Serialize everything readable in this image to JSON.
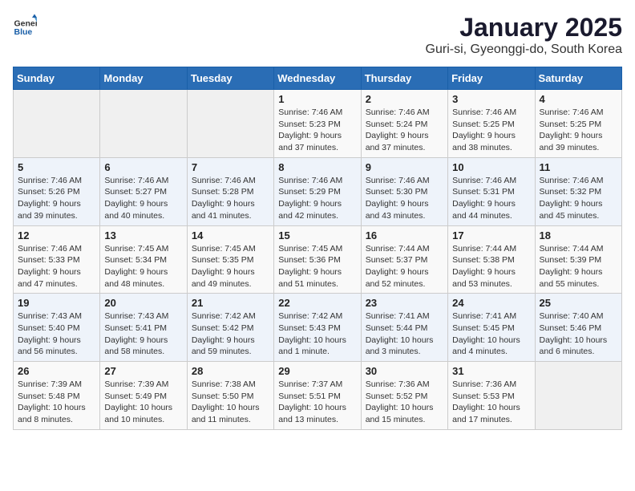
{
  "header": {
    "logo": {
      "general": "General",
      "blue": "Blue"
    },
    "title": "January 2025",
    "subtitle": "Guri-si, Gyeonggi-do, South Korea"
  },
  "weekdays": [
    "Sunday",
    "Monday",
    "Tuesday",
    "Wednesday",
    "Thursday",
    "Friday",
    "Saturday"
  ],
  "weeks": [
    [
      {
        "day": "",
        "sunrise": "",
        "sunset": "",
        "daylight": ""
      },
      {
        "day": "",
        "sunrise": "",
        "sunset": "",
        "daylight": ""
      },
      {
        "day": "",
        "sunrise": "",
        "sunset": "",
        "daylight": ""
      },
      {
        "day": "1",
        "sunrise": "Sunrise: 7:46 AM",
        "sunset": "Sunset: 5:23 PM",
        "daylight": "Daylight: 9 hours and 37 minutes."
      },
      {
        "day": "2",
        "sunrise": "Sunrise: 7:46 AM",
        "sunset": "Sunset: 5:24 PM",
        "daylight": "Daylight: 9 hours and 37 minutes."
      },
      {
        "day": "3",
        "sunrise": "Sunrise: 7:46 AM",
        "sunset": "Sunset: 5:25 PM",
        "daylight": "Daylight: 9 hours and 38 minutes."
      },
      {
        "day": "4",
        "sunrise": "Sunrise: 7:46 AM",
        "sunset": "Sunset: 5:25 PM",
        "daylight": "Daylight: 9 hours and 39 minutes."
      }
    ],
    [
      {
        "day": "5",
        "sunrise": "Sunrise: 7:46 AM",
        "sunset": "Sunset: 5:26 PM",
        "daylight": "Daylight: 9 hours and 39 minutes."
      },
      {
        "day": "6",
        "sunrise": "Sunrise: 7:46 AM",
        "sunset": "Sunset: 5:27 PM",
        "daylight": "Daylight: 9 hours and 40 minutes."
      },
      {
        "day": "7",
        "sunrise": "Sunrise: 7:46 AM",
        "sunset": "Sunset: 5:28 PM",
        "daylight": "Daylight: 9 hours and 41 minutes."
      },
      {
        "day": "8",
        "sunrise": "Sunrise: 7:46 AM",
        "sunset": "Sunset: 5:29 PM",
        "daylight": "Daylight: 9 hours and 42 minutes."
      },
      {
        "day": "9",
        "sunrise": "Sunrise: 7:46 AM",
        "sunset": "Sunset: 5:30 PM",
        "daylight": "Daylight: 9 hours and 43 minutes."
      },
      {
        "day": "10",
        "sunrise": "Sunrise: 7:46 AM",
        "sunset": "Sunset: 5:31 PM",
        "daylight": "Daylight: 9 hours and 44 minutes."
      },
      {
        "day": "11",
        "sunrise": "Sunrise: 7:46 AM",
        "sunset": "Sunset: 5:32 PM",
        "daylight": "Daylight: 9 hours and 45 minutes."
      }
    ],
    [
      {
        "day": "12",
        "sunrise": "Sunrise: 7:46 AM",
        "sunset": "Sunset: 5:33 PM",
        "daylight": "Daylight: 9 hours and 47 minutes."
      },
      {
        "day": "13",
        "sunrise": "Sunrise: 7:45 AM",
        "sunset": "Sunset: 5:34 PM",
        "daylight": "Daylight: 9 hours and 48 minutes."
      },
      {
        "day": "14",
        "sunrise": "Sunrise: 7:45 AM",
        "sunset": "Sunset: 5:35 PM",
        "daylight": "Daylight: 9 hours and 49 minutes."
      },
      {
        "day": "15",
        "sunrise": "Sunrise: 7:45 AM",
        "sunset": "Sunset: 5:36 PM",
        "daylight": "Daylight: 9 hours and 51 minutes."
      },
      {
        "day": "16",
        "sunrise": "Sunrise: 7:44 AM",
        "sunset": "Sunset: 5:37 PM",
        "daylight": "Daylight: 9 hours and 52 minutes."
      },
      {
        "day": "17",
        "sunrise": "Sunrise: 7:44 AM",
        "sunset": "Sunset: 5:38 PM",
        "daylight": "Daylight: 9 hours and 53 minutes."
      },
      {
        "day": "18",
        "sunrise": "Sunrise: 7:44 AM",
        "sunset": "Sunset: 5:39 PM",
        "daylight": "Daylight: 9 hours and 55 minutes."
      }
    ],
    [
      {
        "day": "19",
        "sunrise": "Sunrise: 7:43 AM",
        "sunset": "Sunset: 5:40 PM",
        "daylight": "Daylight: 9 hours and 56 minutes."
      },
      {
        "day": "20",
        "sunrise": "Sunrise: 7:43 AM",
        "sunset": "Sunset: 5:41 PM",
        "daylight": "Daylight: 9 hours and 58 minutes."
      },
      {
        "day": "21",
        "sunrise": "Sunrise: 7:42 AM",
        "sunset": "Sunset: 5:42 PM",
        "daylight": "Daylight: 9 hours and 59 minutes."
      },
      {
        "day": "22",
        "sunrise": "Sunrise: 7:42 AM",
        "sunset": "Sunset: 5:43 PM",
        "daylight": "Daylight: 10 hours and 1 minute."
      },
      {
        "day": "23",
        "sunrise": "Sunrise: 7:41 AM",
        "sunset": "Sunset: 5:44 PM",
        "daylight": "Daylight: 10 hours and 3 minutes."
      },
      {
        "day": "24",
        "sunrise": "Sunrise: 7:41 AM",
        "sunset": "Sunset: 5:45 PM",
        "daylight": "Daylight: 10 hours and 4 minutes."
      },
      {
        "day": "25",
        "sunrise": "Sunrise: 7:40 AM",
        "sunset": "Sunset: 5:46 PM",
        "daylight": "Daylight: 10 hours and 6 minutes."
      }
    ],
    [
      {
        "day": "26",
        "sunrise": "Sunrise: 7:39 AM",
        "sunset": "Sunset: 5:48 PM",
        "daylight": "Daylight: 10 hours and 8 minutes."
      },
      {
        "day": "27",
        "sunrise": "Sunrise: 7:39 AM",
        "sunset": "Sunset: 5:49 PM",
        "daylight": "Daylight: 10 hours and 10 minutes."
      },
      {
        "day": "28",
        "sunrise": "Sunrise: 7:38 AM",
        "sunset": "Sunset: 5:50 PM",
        "daylight": "Daylight: 10 hours and 11 minutes."
      },
      {
        "day": "29",
        "sunrise": "Sunrise: 7:37 AM",
        "sunset": "Sunset: 5:51 PM",
        "daylight": "Daylight: 10 hours and 13 minutes."
      },
      {
        "day": "30",
        "sunrise": "Sunrise: 7:36 AM",
        "sunset": "Sunset: 5:52 PM",
        "daylight": "Daylight: 10 hours and 15 minutes."
      },
      {
        "day": "31",
        "sunrise": "Sunrise: 7:36 AM",
        "sunset": "Sunset: 5:53 PM",
        "daylight": "Daylight: 10 hours and 17 minutes."
      },
      {
        "day": "",
        "sunrise": "",
        "sunset": "",
        "daylight": ""
      }
    ]
  ]
}
